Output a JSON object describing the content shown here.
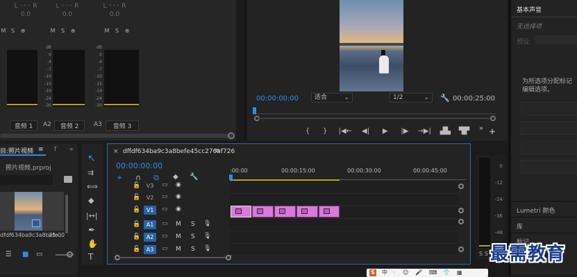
{
  "audio_mixer": {
    "top_labels": [
      "L ◦◦◦ R",
      "L ◦◦◦ R",
      "L ◦◦◦ R"
    ],
    "top_values": [
      "0.0",
      "0.0",
      "0.0"
    ],
    "msr": [
      "M",
      "S",
      "⊕"
    ],
    "db_labels": [
      "dB",
      "0",
      "-4",
      "-7",
      "-10",
      "-15",
      "-19",
      "-24",
      "-30",
      "-36"
    ],
    "channels": [
      {
        "id": "",
        "name": "音频 1"
      },
      {
        "id": "A2",
        "name": "音频 2"
      },
      {
        "id": "A3",
        "name": "音频 3"
      }
    ]
  },
  "program_monitor": {
    "timecode": "00:00:00:00",
    "fit": "适合",
    "resolution": "1/2",
    "duration": "00:00:25:00",
    "transport": [
      "{",
      "}",
      "|◀←",
      "◀|",
      "▶",
      "|▶",
      "→▶|"
    ]
  },
  "project": {
    "title": "目:照片视频",
    "tabs": [
      "f",
      "»"
    ],
    "file": "照片视频.prproj",
    "clip_name": "dfdf634ba9c3a8befe...",
    "clip_duration": "25:00"
  },
  "timeline": {
    "sequence_name": "dffdf634ba9c3a8befe45cc276af726",
    "timecode": "00:00:00:00",
    "ruler": [
      ":00:00",
      "00:00:15:00",
      "00:00:30:00",
      "00:00:45:00"
    ],
    "video_tracks": [
      "V3",
      "V2",
      "V1"
    ],
    "audio_tracks": [
      "A1",
      "A2",
      "A3"
    ],
    "ms": [
      "M",
      "S"
    ],
    "clip_count": 5
  },
  "essential_sound": {
    "title": "基本声音",
    "no_selection": "无选择项",
    "preset_label": "预设:",
    "hint_line1": "为所选项分配标记",
    "hint_line2": "编辑选项。",
    "lumetri": "Lumetri 颜色",
    "library": "库",
    "marker": "标记"
  },
  "meter_right": {
    "labels": [
      "0",
      "-12",
      "-24",
      "-36",
      "-48"
    ],
    "solo": [
      "S",
      "S"
    ]
  },
  "watermark": "最需教育",
  "taskbar_icons": [
    "S",
    "中",
    "·",
    "☺",
    "🎤",
    "⌨",
    "👕",
    "▦"
  ]
}
